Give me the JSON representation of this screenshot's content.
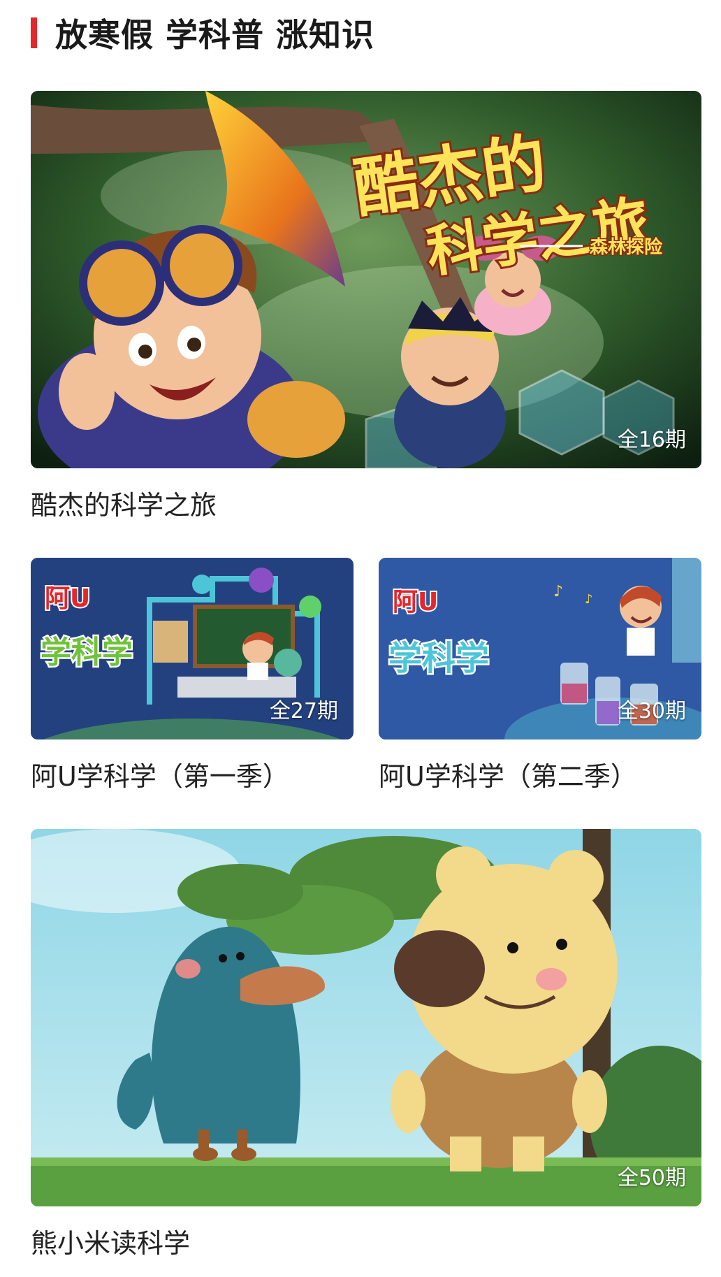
{
  "section": {
    "title": "放寒假 学科普 涨知识",
    "accent_color": "#e5262b"
  },
  "cards": [
    {
      "title": "酷杰的科学之旅",
      "episodes": "全16期",
      "art_title_line1": "酷杰的",
      "art_title_line2": "科学之旅",
      "art_subtitle": "森林探险"
    },
    {
      "title": "阿U学科学（第一季）",
      "episodes": "全27期",
      "art_logo_top": "阿U",
      "art_logo_bottom": "学科学"
    },
    {
      "title": "阿U学科学（第二季）",
      "episodes": "全30期",
      "art_logo_top": "阿U",
      "art_logo_bottom": "学科学"
    },
    {
      "title": "熊小米读科学",
      "episodes": "全50期"
    }
  ]
}
